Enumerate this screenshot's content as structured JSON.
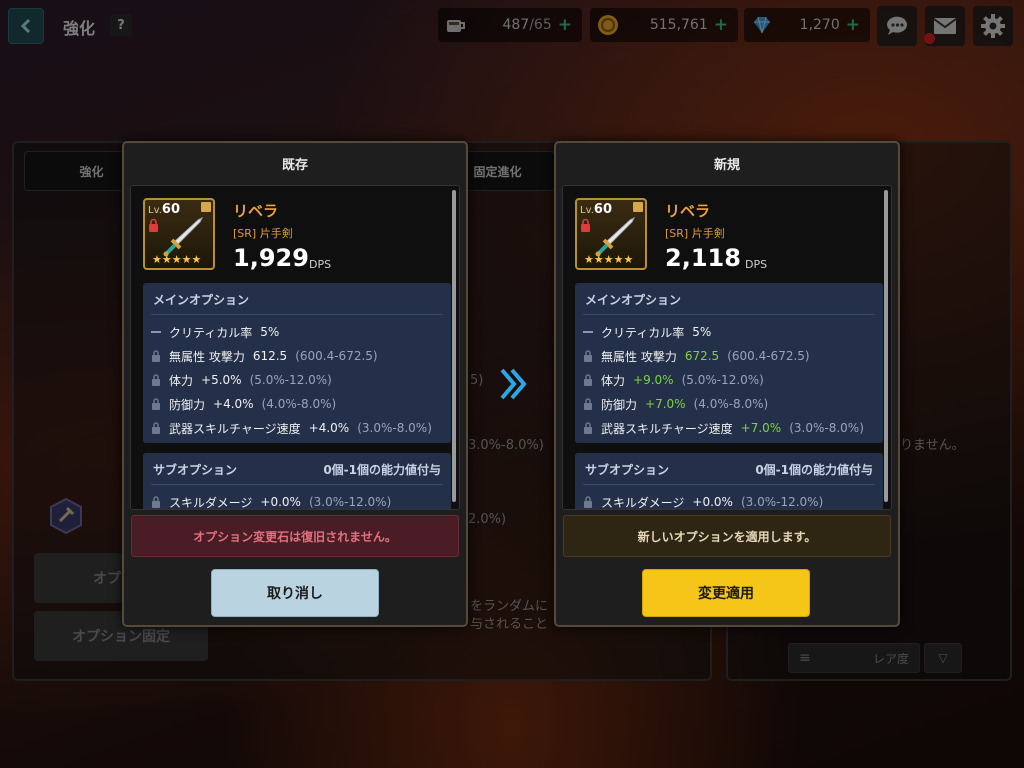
{
  "colors": {
    "accent_gold": "#f5c518",
    "stat_up_green": "#7ed43a",
    "rarity_orange": "#f0a040",
    "warning_red": "#e2707e"
  },
  "header": {
    "back_icon": "chevron-left-icon",
    "title": "強化",
    "help_label": "?"
  },
  "resources": {
    "stamina": {
      "icon": "coffee-cup-icon",
      "value": "487",
      "max": "/65",
      "plus": "+"
    },
    "gold": {
      "icon": "gold-coin-icon",
      "value": "515,761",
      "plus": "+"
    },
    "gems": {
      "icon": "diamond-icon",
      "value": "1,270",
      "plus": "+"
    }
  },
  "top_icons": [
    "chat-icon",
    "mail-icon",
    "gear-icon"
  ],
  "background_ui": {
    "tab_enhance": "強化",
    "tab_fixed_evolve": "固定進化",
    "button_option_change_partial": "オプショ",
    "button_option_fix": "オプション固定",
    "text_random_partial": "をランダムに",
    "text_granted_partial": "与されること",
    "text_range_partial": "3.0%-8.0%)",
    "text_percent_partial": "2.0%)",
    "text_right_partial": "りません。",
    "sort_label": "レア度",
    "sort_icon": "menu-lines-icon",
    "filter_icon": "triangle-down-icon"
  },
  "existing": {
    "header": "既存",
    "item": {
      "level_prefix": "Lv.",
      "level": "60",
      "name": "リベラ",
      "type": "[SR] 片手剣",
      "stars": "★★★★★",
      "dps": "1,929",
      "dps_label": "DPS"
    },
    "main_option_title": "メインオプション",
    "main_options": [
      {
        "name": "クリティカル率",
        "value": "5%",
        "range": ""
      },
      {
        "name": "無属性 攻撃力",
        "value": "612.5",
        "range": "(600.4-672.5)"
      },
      {
        "name": "体力",
        "value": "+5.0%",
        "range": "(5.0%-12.0%)"
      },
      {
        "name": "防御力",
        "value": "+4.0%",
        "range": "(4.0%-8.0%)"
      },
      {
        "name": "武器スキルチャージ速度",
        "value": "+4.0%",
        "range": "(3.0%-8.0%)"
      }
    ],
    "sub_option_title": "サブオプション",
    "sub_option_info": "0個-1個の能力値付与",
    "sub_options": [
      {
        "name": "スキルダメージ",
        "value": "+0.0%",
        "range": "(3.0%-12.0%)"
      }
    ],
    "notice": "オプション変更石は復旧されません。",
    "button": "取り消し"
  },
  "new": {
    "header": "新規",
    "item": {
      "level_prefix": "Lv.",
      "level": "60",
      "name": "リベラ",
      "type": "[SR] 片手剣",
      "stars": "★★★★★",
      "dps": "2,118",
      "dps_label": "DPS"
    },
    "main_option_title": "メインオプション",
    "main_options": [
      {
        "name": "クリティカル率",
        "value": "5%",
        "range": ""
      },
      {
        "name": "無属性 攻撃力",
        "value": "672.5",
        "range": "(600.4-672.5)"
      },
      {
        "name": "体力",
        "value": "+9.0%",
        "range": "(5.0%-12.0%)"
      },
      {
        "name": "防御力",
        "value": "+7.0%",
        "range": "(4.0%-8.0%)"
      },
      {
        "name": "武器スキルチャージ速度",
        "value": "+7.0%",
        "range": "(3.0%-8.0%)"
      }
    ],
    "sub_option_title": "サブオプション",
    "sub_option_info": "0個-1個の能力値付与",
    "sub_options": [
      {
        "name": "スキルダメージ",
        "value": "+0.0%",
        "range": "(3.0%-12.0%)"
      }
    ],
    "notice": "新しいオプションを適用します。",
    "button": "変更適用"
  }
}
